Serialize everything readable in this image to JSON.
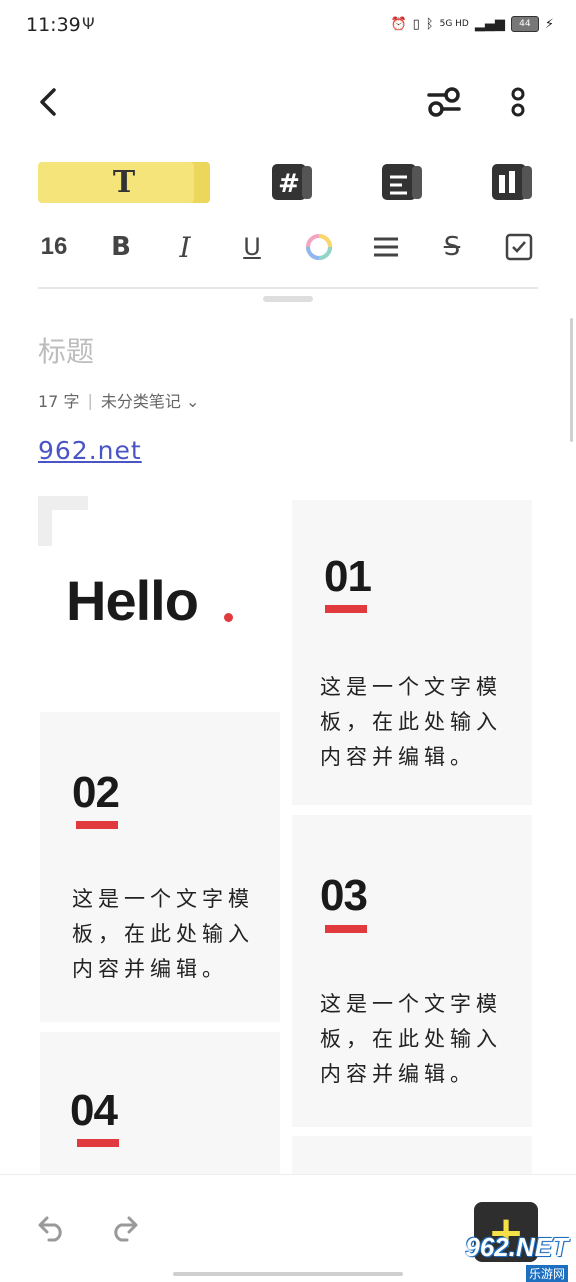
{
  "status": {
    "time": "11:39",
    "usb": "Ψ",
    "network": "5G HD",
    "battery": "44"
  },
  "toolbar": {
    "back_icon": "chevron-left-icon",
    "settings_icon": "sliders-icon",
    "more_icon": "more-vertical-icon"
  },
  "template_tabs": [
    {
      "label": "T",
      "icon": "text-style-icon",
      "selected": true
    },
    {
      "label": "",
      "icon": "hash-template-icon",
      "selected": false
    },
    {
      "label": "",
      "icon": "paragraph-template-icon",
      "selected": false
    },
    {
      "label": "",
      "icon": "layout-template-icon",
      "selected": false
    }
  ],
  "format_bar": {
    "font_size": "16",
    "bold": "B",
    "italic": "I",
    "underline": "U",
    "strikethrough": "S"
  },
  "note": {
    "title_placeholder": "标题",
    "word_count": "17 字",
    "category": "未分类笔记",
    "link": "962.net"
  },
  "template_content": {
    "hello": "Hello",
    "cards": [
      {
        "number": "01",
        "text": "这是一个文字模板，在此处输入内容并编辑。"
      },
      {
        "number": "02",
        "text": "这是一个文字模板，在此处输入内容并编辑。"
      },
      {
        "number": "03",
        "text": "这是一个文字模板，在此处输入内容并编辑。"
      },
      {
        "number": "04",
        "text": ""
      }
    ]
  },
  "bottom": {
    "undo_icon": "undo-icon",
    "redo_icon": "redo-icon",
    "add_label": "+"
  },
  "watermark": {
    "brand": "962.NET",
    "sub": "乐游网"
  },
  "colors": {
    "accent_yellow": "#f5e47a",
    "accent_red": "#e0393e",
    "link_blue": "#4a54c4"
  }
}
